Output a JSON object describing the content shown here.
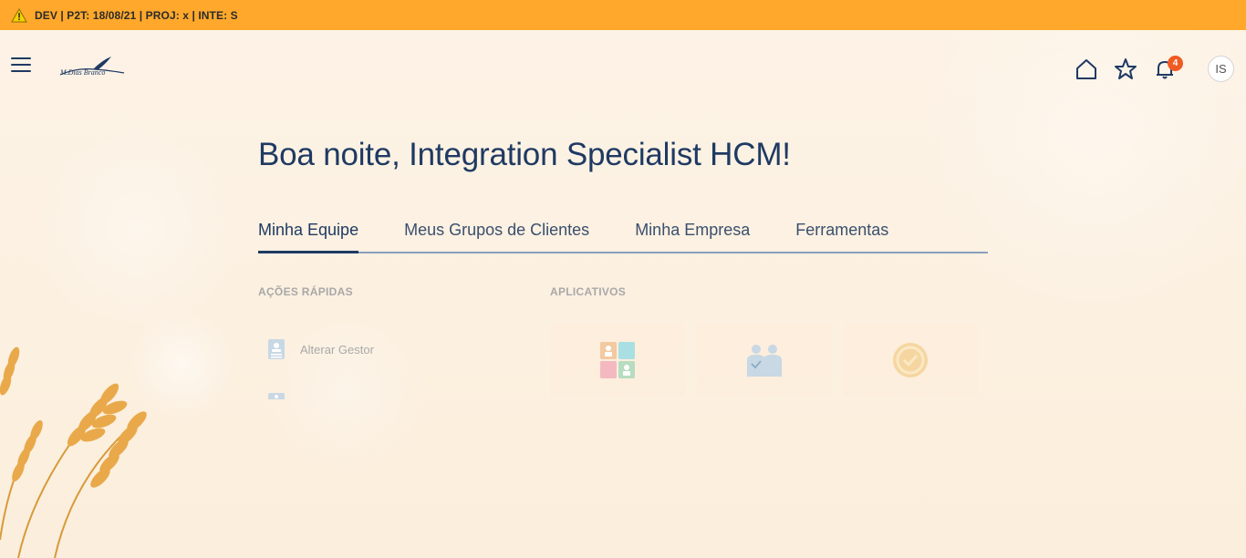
{
  "env_banner": {
    "text": "DEV | P2T: 18/08/21 | PROJ: x | INTE: S",
    "color": "#ffa82b"
  },
  "header": {
    "notifications_count": "4",
    "avatar_initials": "IS",
    "icons": [
      "menu-icon",
      "logo",
      "home-icon",
      "star-icon",
      "bell-icon"
    ]
  },
  "main": {
    "greeting": "Boa noite, Integration Specialist HCM!",
    "tabs": [
      {
        "label": "Minha Equipe",
        "active": true
      },
      {
        "label": "Meus Grupos de Clientes",
        "active": false
      },
      {
        "label": "Minha Empresa",
        "active": false
      },
      {
        "label": "Ferramentas",
        "active": false
      }
    ],
    "quick_actions_title": "AÇÕES RÁPIDAS",
    "quick_actions": [
      {
        "label": "Alterar Gestor"
      }
    ],
    "apps_title": "APLICATIVOS"
  },
  "colors": {
    "accent": "#1f3a63",
    "badge": "#f05a23",
    "background": "#fcf1e2"
  }
}
